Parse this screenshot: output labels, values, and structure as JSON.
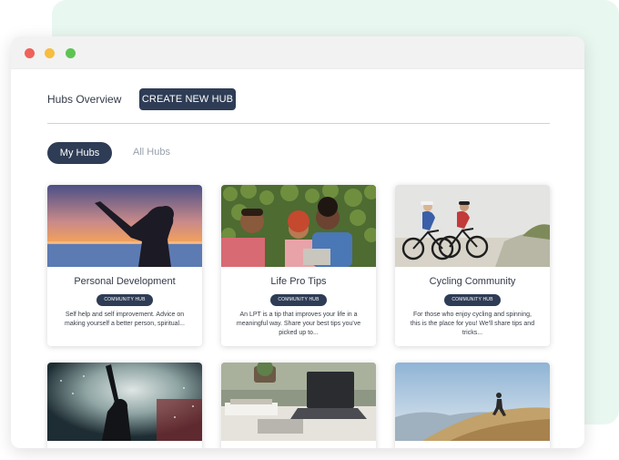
{
  "header": {
    "title": "Hubs Overview",
    "create_label": "CREATE NEW HUB"
  },
  "tabs": {
    "my_hubs": "My Hubs",
    "all_hubs": "All Hubs",
    "active": "My Hubs"
  },
  "colors": {
    "primary": "#2e3c55",
    "accent_bg": "#e9f7f1",
    "dot_red": "#ef6159",
    "dot_yellow": "#f6bd3f",
    "dot_green": "#5dc454"
  },
  "hubs": [
    {
      "title": "Personal Development",
      "badge": "COMMUNITY HUB",
      "description": "Self help and self improvement. Advice on making yourself a better person, spiritual..."
    },
    {
      "title": "Life Pro Tips",
      "badge": "COMMUNITY HUB",
      "description": "An LPT is a tip that improves your life in a meaningful way. Share your best tips you've picked up to..."
    },
    {
      "title": "Cycling Community",
      "badge": "COMMUNITY HUB",
      "description": "For those who enjoy cycling and spinning, this is the place for you! We'll share tips and tricks..."
    }
  ]
}
